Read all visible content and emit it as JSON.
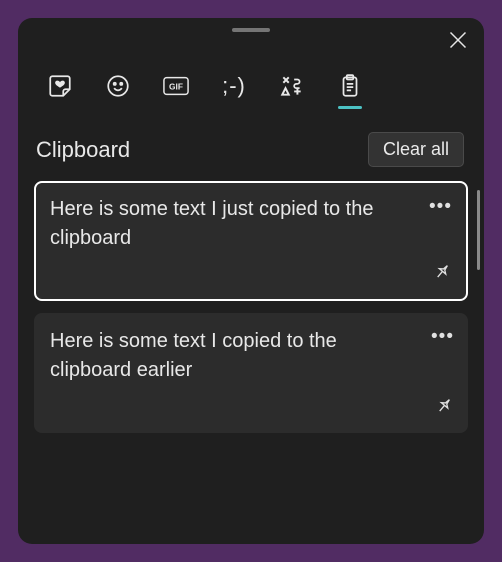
{
  "panel": {
    "title": "Clipboard",
    "clear_label": "Clear all"
  },
  "tabs": {
    "wink_label": ";-)"
  },
  "items": [
    {
      "text": "Here is some text I just copied to the clipboard",
      "selected": true
    },
    {
      "text": "Here is some text I copied to the clipboard earlier",
      "selected": false
    }
  ]
}
